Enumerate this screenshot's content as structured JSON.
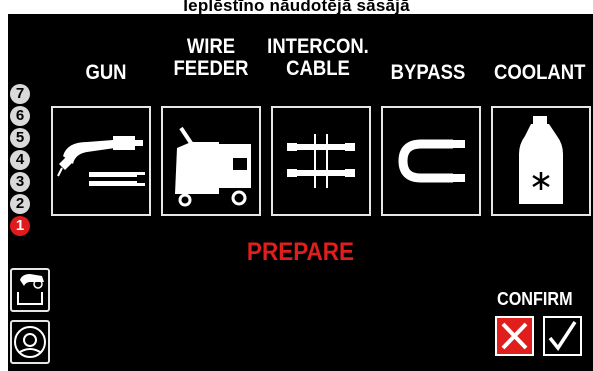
{
  "title": "Ieplēstīno nāudotējā sāsājā",
  "tiles": [
    {
      "label": "GUN",
      "icon": "welding-gun-icon"
    },
    {
      "label": "WIRE\nFEEDER",
      "icon": "wire-feeder-icon"
    },
    {
      "label": "INTERCON.\nCABLE",
      "icon": "interconnection-cable-icon"
    },
    {
      "label": "BYPASS",
      "icon": "bypass-hose-icon"
    },
    {
      "label": "COOLANT",
      "icon": "coolant-bottle-icon"
    }
  ],
  "steps": [
    "7",
    "6",
    "5",
    "4",
    "3",
    "2",
    "1"
  ],
  "active_step": "1",
  "status": "PREPARE",
  "confirm": {
    "label": "CONFIRM",
    "cancel_icon": "x-icon",
    "ok_icon": "checkmark-icon"
  },
  "side_buttons": [
    {
      "icon": "gun-cooling-icon"
    },
    {
      "icon": "coolant-unit-icon"
    }
  ],
  "colors": {
    "background": "#000000",
    "accent": "#e01e1e",
    "text": "#ffffff"
  }
}
